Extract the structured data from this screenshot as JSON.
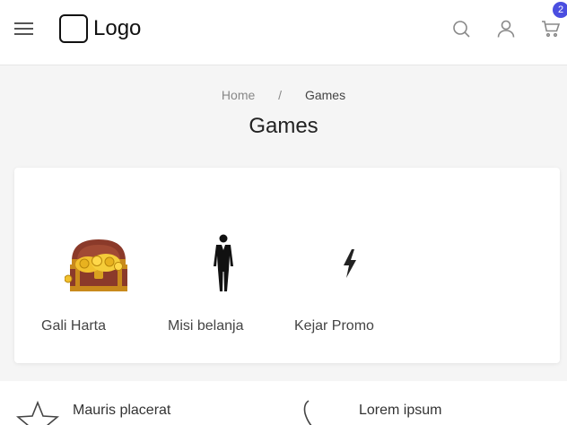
{
  "header": {
    "menu_icon": "hamburger-menu-icon",
    "logo_text": "Logo",
    "search_icon": "search-icon",
    "account_icon": "user-icon",
    "cart_icon": "cart-icon",
    "cart_count": "2",
    "badge_color": "#4a4ee0"
  },
  "breadcrumb": {
    "home": "Home",
    "separator": "/",
    "current": "Games"
  },
  "page": {
    "title": "Games"
  },
  "games": [
    {
      "label": "Gali Harta",
      "icon": "treasure-chest-icon"
    },
    {
      "label": "Misi belanja",
      "icon": "businessman-silhouette-icon"
    },
    {
      "label": "Kejar Promo",
      "icon": "lightning-bolt-icon"
    }
  ],
  "features": [
    {
      "title": "Mauris placerat",
      "icon": "star-icon"
    },
    {
      "title": "Lorem ipsum",
      "icon": "phone-icon"
    }
  ]
}
